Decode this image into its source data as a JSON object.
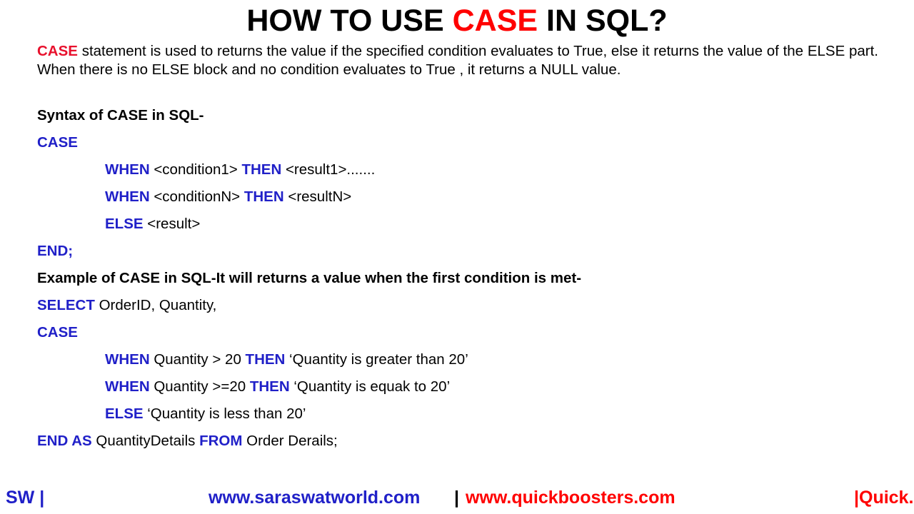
{
  "title": {
    "part1": "HOW TO USE ",
    "highlight": "CASE",
    "part2": " IN SQL?"
  },
  "intro": {
    "keyword": "CASE",
    "text": " statement is used to returns the value if the specified condition evaluates to True, else it returns the  value of the ELSE part. When there is no ELSE block and no condition evaluates to True , it returns a NULL value."
  },
  "syntax": {
    "heading": "Syntax of CASE in SQL-",
    "case": "CASE",
    "when1_kw": "WHEN",
    "when1_cond": " <condition1> ",
    "then1_kw": "THEN",
    "then1_res": " <result1>.......",
    "when2_kw": "WHEN",
    "when2_cond": " <conditionN> ",
    "then2_kw": "THEN",
    "then2_res": " <resultN>",
    "else_kw": "ELSE",
    "else_res": " <result>",
    "end": "END;"
  },
  "example": {
    "heading": "Example of CASE in SQL-It will returns a value when the first condition is met-",
    "select_kw": "SELECT",
    "select_cols": " OrderID, Quantity,",
    "case": "CASE",
    "when1_kw": "WHEN",
    "when1_cond": " Quantity > 20 ",
    "then1_kw": "THEN",
    "then1_res": "  ‘Quantity is greater than 20’",
    "when2_kw": "WHEN",
    "when2_cond": " Quantity >=20 ",
    "then2_kw": "THEN",
    "then2_res": "  ‘Quantity is equak to 20’",
    "else_kw": "ELSE",
    "else_res": " ‘Quantity is less than 20’",
    "end_kw": "END AS",
    "end_alias": " QuantityDetails ",
    "from_kw": "FROM",
    "from_table": " Order Derails;"
  },
  "footer": {
    "left": "SW |",
    "site1": "www.saraswatworld.com",
    "separator": "|",
    "site2": "www.quickboosters.com",
    "right": "|Quick."
  },
  "colors": {
    "keyword_blue": "#2020C8",
    "highlight_red": "#FF0000",
    "intro_red": "#E8112D",
    "text_black": "#000000",
    "background": "#FFFFFF"
  }
}
